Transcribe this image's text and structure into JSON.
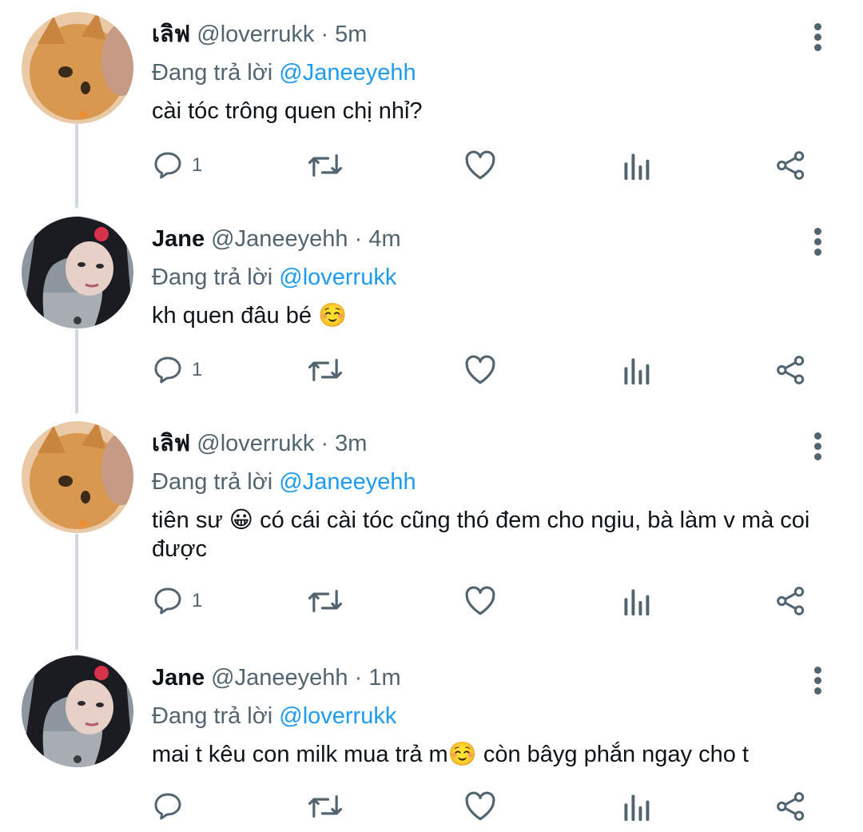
{
  "tweets": [
    {
      "name": "เลิฟ",
      "handle": "@loverrukk",
      "separator": "·",
      "time": "5m",
      "replying_prefix": "Đang trả lời",
      "replying_to": "@Janeeyehh",
      "text": "cài tóc trông quen chị nhỉ?",
      "reply_count": "1",
      "avatar": "cat-avatar"
    },
    {
      "name": "Jane",
      "handle": "@Janeeyehh",
      "separator": "·",
      "time": "4m",
      "replying_prefix": "Đang trả lời",
      "replying_to": "@loverrukk",
      "text": "kh quen đâu bé ☺️",
      "reply_count": "1",
      "avatar": "girl-avatar"
    },
    {
      "name": "เลิฟ",
      "handle": "@loverrukk",
      "separator": "·",
      "time": "3m",
      "replying_prefix": "Đang trả lời",
      "replying_to": "@Janeeyehh",
      "text": "tiên sư 😀 có cái cài tóc cũng thó đem cho ngiu, bà làm v mà coi được",
      "reply_count": "1",
      "avatar": "cat-avatar"
    },
    {
      "name": "Jane",
      "handle": "@Janeeyehh",
      "separator": "·",
      "time": "1m",
      "replying_prefix": "Đang trả lời",
      "replying_to": "@loverrukk",
      "text": "mai t kêu con milk mua trả m☺️ còn bâyg phắn ngay cho t",
      "reply_count": "",
      "avatar": "girl-avatar"
    }
  ],
  "colors": {
    "text": "#0f1419",
    "secondary": "#536471",
    "accent": "#1d9bf0",
    "thread_line": "#cfd9de"
  },
  "icons": [
    "reply-icon",
    "retweet-icon",
    "like-icon",
    "stats-icon",
    "share-icon",
    "more-icon"
  ]
}
